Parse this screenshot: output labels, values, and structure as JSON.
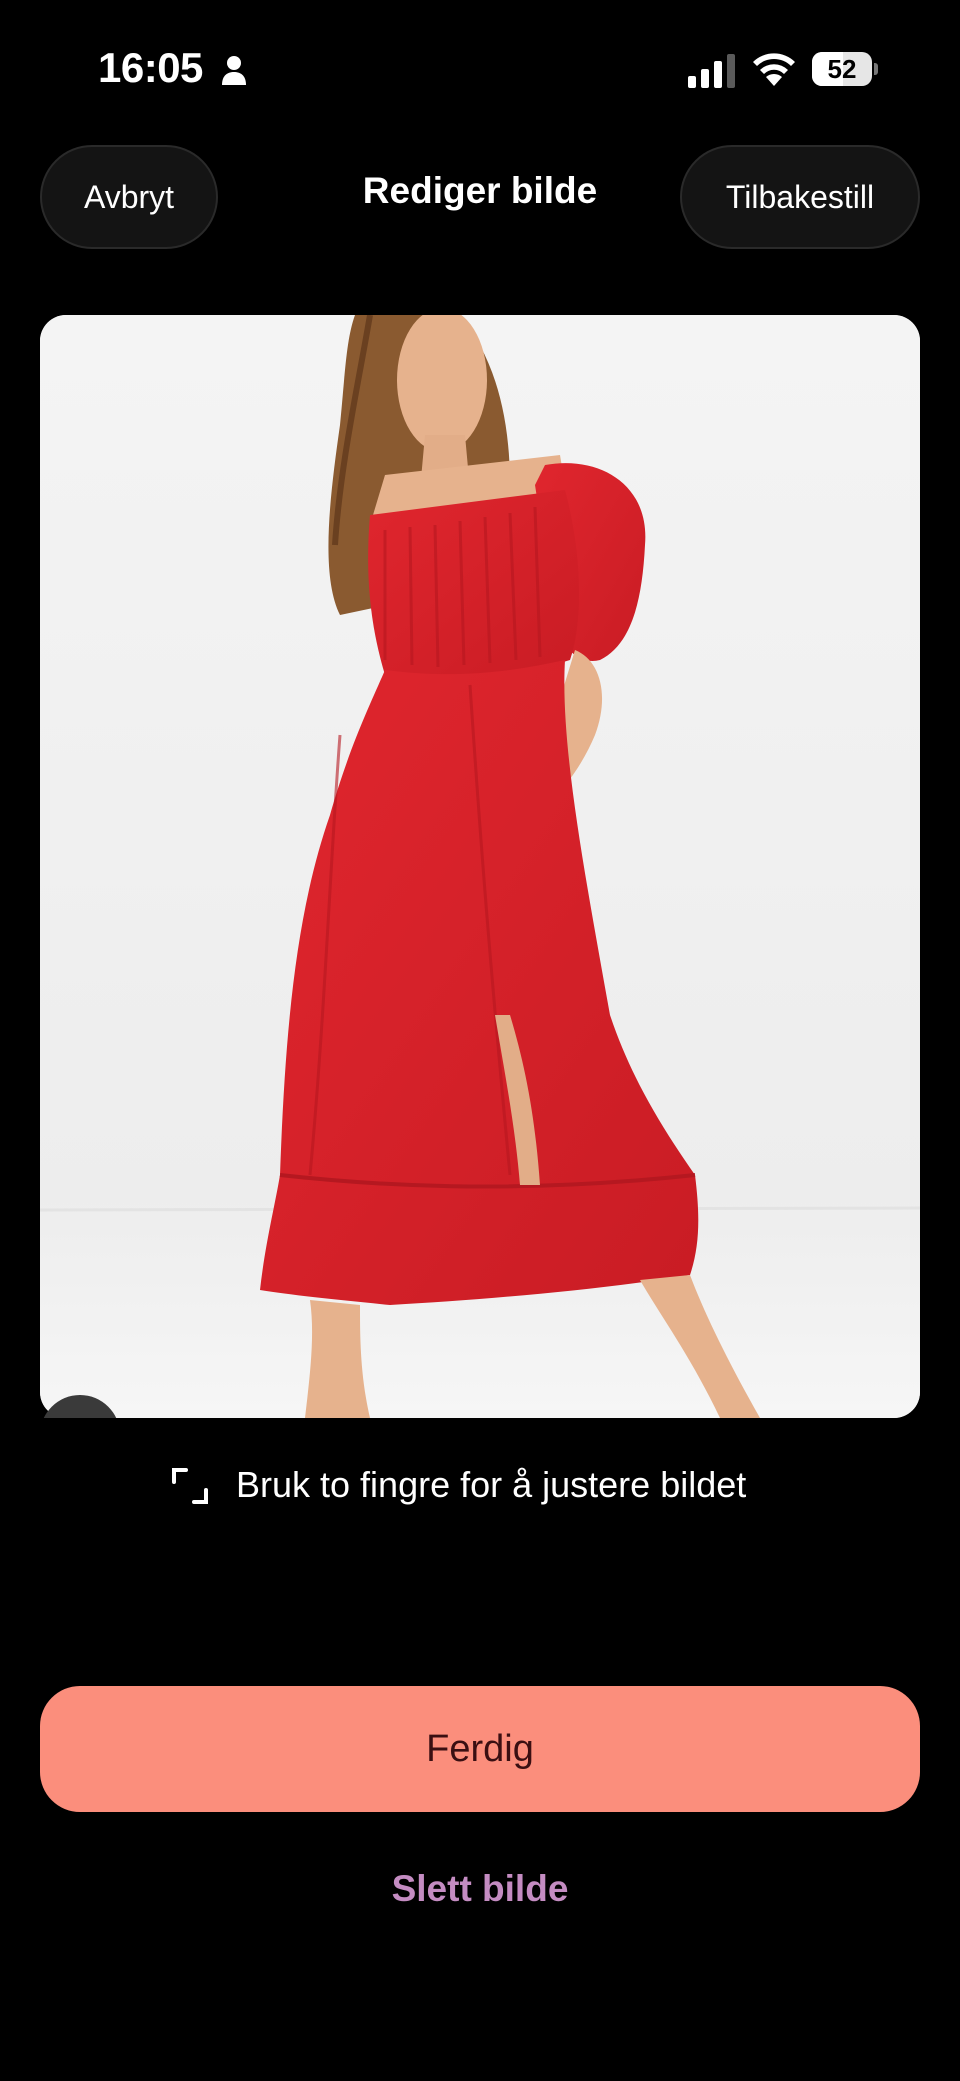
{
  "status_bar": {
    "time": "16:05",
    "battery_level": "52",
    "icons": [
      "person-icon",
      "cellular-signal-icon",
      "wifi-icon",
      "battery-icon"
    ]
  },
  "header": {
    "cancel_label": "Avbryt",
    "title": "Rediger bilde",
    "reset_label": "Tilbakestill"
  },
  "image": {
    "description_icon": "photo-red-dress"
  },
  "hint": {
    "icon": "crop-icon",
    "text": "Bruk to fingre for å justere bildet"
  },
  "actions": {
    "done_label": "Ferdig",
    "delete_label": "Slett bilde"
  },
  "colors": {
    "background": "#000000",
    "accent_button": "#fb8e7c",
    "accent_button_text": "#3a0f12",
    "delete_text": "#c48cc2",
    "dress": "#d8242b"
  }
}
